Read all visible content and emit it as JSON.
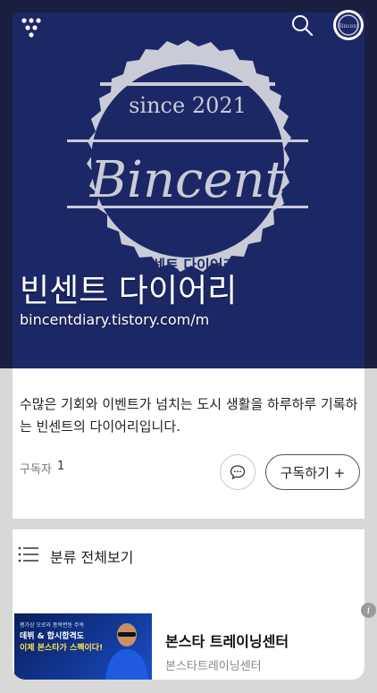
{
  "header": {
    "menu_icon": "menu-dots-icon",
    "search_icon": "search-icon",
    "profile_avatar_text": "Bincent"
  },
  "hero": {
    "logo_since": "since 2021",
    "logo_name": "Bincent",
    "logo_korean": "빈센트 다이어리",
    "title": "빈센트 다이어리",
    "url": "bincentdiary.tistory.com/m",
    "colors": {
      "background": "#1c2866",
      "badge": "#c9ccd6"
    }
  },
  "info": {
    "description": "수많은 기회와 이벤트가 넘치는 도시 생활을 하루하루 기록하는 빈센트의 다이어리입니다.",
    "subscribers_label": "구독자",
    "subscribers_count": "1",
    "subscribe_button": "구독하기 +"
  },
  "category": {
    "label": "분류 전체보기"
  },
  "ad": {
    "thumb_line1": "평가상 오로라 종목변동 주목",
    "thumb_line2": "데뷔 & 합시합격도",
    "thumb_line3": "이제 본스타가 스펙이다!",
    "title": "본스타 트레이닝센터",
    "advertiser": "본스타트레이닝센터"
  }
}
